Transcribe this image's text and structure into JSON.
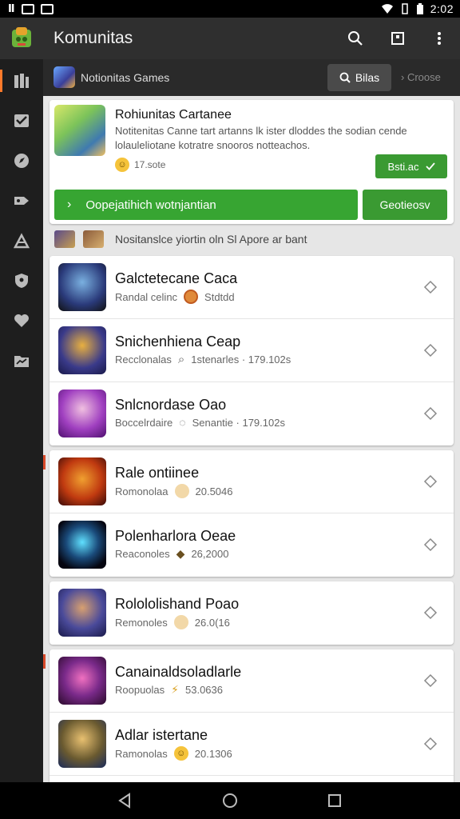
{
  "status": {
    "left_icons": [
      "notification-icon",
      "mail-icon",
      "gmail-icon"
    ],
    "time": "2:02"
  },
  "app": {
    "title": "Komunitas"
  },
  "sidebar": {
    "items": [
      {
        "name": "library-icon"
      },
      {
        "name": "inbox-icon"
      },
      {
        "name": "compass-icon"
      },
      {
        "name": "tag-icon"
      },
      {
        "name": "puzzle-icon"
      },
      {
        "name": "shield-icon"
      },
      {
        "name": "heart-icon"
      },
      {
        "name": "folder-icon"
      }
    ]
  },
  "subbar": {
    "title": "Notionitas Games",
    "button_label": "Bilas",
    "link_label": "Croose"
  },
  "featured": {
    "title": "Rohiunitas Cartanee",
    "description": "Notitenitas Canne tart artanns lk ister dloddes the sodian cende lolauleliotane kotratre snooros notteachos.",
    "rating_text": "17.sote",
    "small_button": "Bsti.ac",
    "big_button": "Oopejatihich wotnjantian",
    "alt_button": "Geotieosv"
  },
  "notification": {
    "text": "Nositanslce yiortin oln Sl Apore ar bant"
  },
  "games": [
    {
      "title": "Galctetecane Caca",
      "subtitle": "Randal celinc",
      "stat": "Stdtdd",
      "group": 0
    },
    {
      "title": "Snichenhiena Ceap",
      "subtitle": "Recclonalas",
      "stat": "1stenarles · 179.102s",
      "group": 0
    },
    {
      "title": "Snlcnordase Oao",
      "subtitle": "Boccelrdaire",
      "stat": "Senantie · 179.102s",
      "group": 0
    },
    {
      "title": "Rale ontiinee",
      "subtitle": "Romonolaa",
      "stat": "20.5046",
      "group": 1
    },
    {
      "title": "Polenharlora Oeae",
      "subtitle": "Reaconoles",
      "stat": "26,2000",
      "group": 1
    },
    {
      "title": "Rolololishand Poao",
      "subtitle": "Remonoles",
      "stat": "26.0(16",
      "group": 2
    },
    {
      "title": "Canainaldsoladlarle",
      "subtitle": "Roopuolas",
      "stat": "53.0636",
      "group": 3
    },
    {
      "title": "Adlar istertane",
      "subtitle": "Ramonolas",
      "stat": "20.1306",
      "group": 3
    }
  ]
}
